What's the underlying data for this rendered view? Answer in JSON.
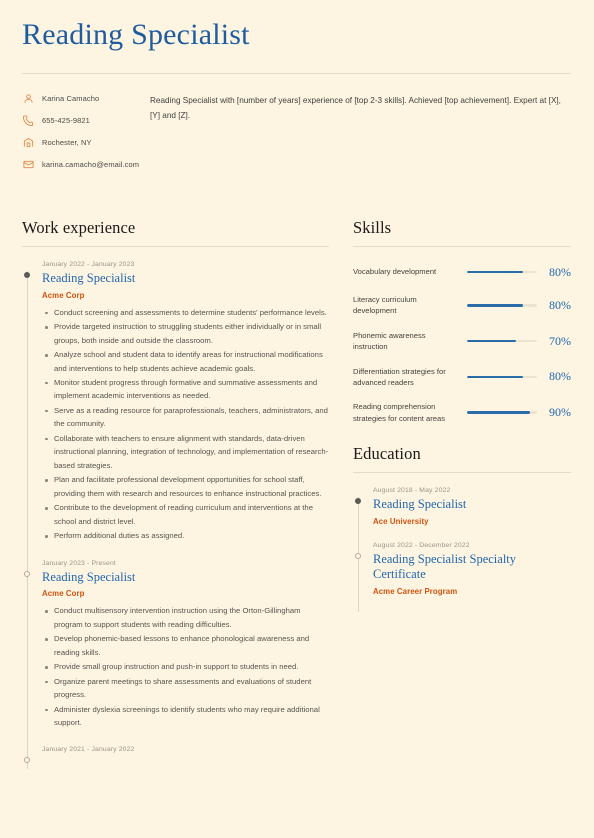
{
  "theme": {
    "background": "#fdf5e2",
    "accent_blue": "#2167ae",
    "accent_orange": "#d2520e",
    "icon_orange": "#e08a4a",
    "rule": "#e6dcc4"
  },
  "header": {
    "title": "Reading Specialist"
  },
  "contact": {
    "items": [
      {
        "icon": "person-icon",
        "text": "Karina Camacho"
      },
      {
        "icon": "phone-icon",
        "text": "655-425-9821"
      },
      {
        "icon": "location-icon",
        "text": "Rochester, NY"
      },
      {
        "icon": "email-icon",
        "text": "karina.camacho@email.com"
      }
    ]
  },
  "summary": {
    "text": "Reading Specialist with [number of years] experience of [top 2-3 skills]. Achieved [top achievement]. Expert at [X], [Y] and [Z]."
  },
  "work_experience": {
    "heading": "Work experience",
    "entries": [
      {
        "date": "January 2022 - January 2023",
        "title": "Reading Specialist",
        "org": "Acme Corp",
        "marker": "filled",
        "bullets": [
          "Conduct screening and assessments to determine students' performance levels.",
          "Provide targeted instruction to struggling students either individually or in small groups, both inside and outside the classroom.",
          "Analyze school and student data to identify areas for instructional modifications and interventions to help students achieve academic goals.",
          "Monitor student progress through formative and summative assessments and implement academic interventions as needed.",
          "Serve as a reading resource for paraprofessionals, teachers, administrators, and the community.",
          "Collaborate with teachers to ensure alignment with standards, data-driven instructional planning, integration of technology, and implementation of research-based strategies.",
          "Plan and facilitate professional development opportunities for school staff, providing them with research and resources to enhance instructional practices.",
          "Contribute to the development of reading curriculum and interventions at the school and district level.",
          "Perform additional duties as assigned."
        ]
      },
      {
        "date": "January 2023 - Present",
        "title": "Reading Specialist",
        "org": "Acme Corp",
        "marker": "hollow",
        "bullets": [
          "Conduct multisensory intervention instruction using the Orton-Gillingham program to support students with reading difficulties.",
          "Develop phonemic-based lessons to enhance phonological awareness and reading skills.",
          "Provide small group instruction and push-in support to students in need.",
          "Organize parent meetings to share assessments and evaluations of student progress.",
          "Administer dyslexia screenings to identify students who may require additional support."
        ]
      },
      {
        "date": "January 2021 - January 2022",
        "title": "",
        "org": "",
        "marker": "hollow",
        "bullets": []
      }
    ]
  },
  "skills": {
    "heading": "Skills",
    "items": [
      {
        "name": "Vocabulary development",
        "percent": "80%",
        "value": 80
      },
      {
        "name": "Literacy curriculum development",
        "percent": "80%",
        "value": 80
      },
      {
        "name": "Phonemic awareness instruction",
        "percent": "70%",
        "value": 70
      },
      {
        "name": "Differentiation strategies for advanced readers",
        "percent": "80%",
        "value": 80
      },
      {
        "name": "Reading comprehension strategies for content areas",
        "percent": "90%",
        "value": 90
      }
    ]
  },
  "education": {
    "heading": "Education",
    "entries": [
      {
        "date": "August 2018 - May 2022",
        "title": "Reading Specialist",
        "org": "Ace University",
        "marker": "filled"
      },
      {
        "date": "August 2022 - December 2022",
        "title": "Reading Specialist Specialty Certificate",
        "org": "Acme Career Program",
        "marker": "hollow"
      }
    ]
  }
}
